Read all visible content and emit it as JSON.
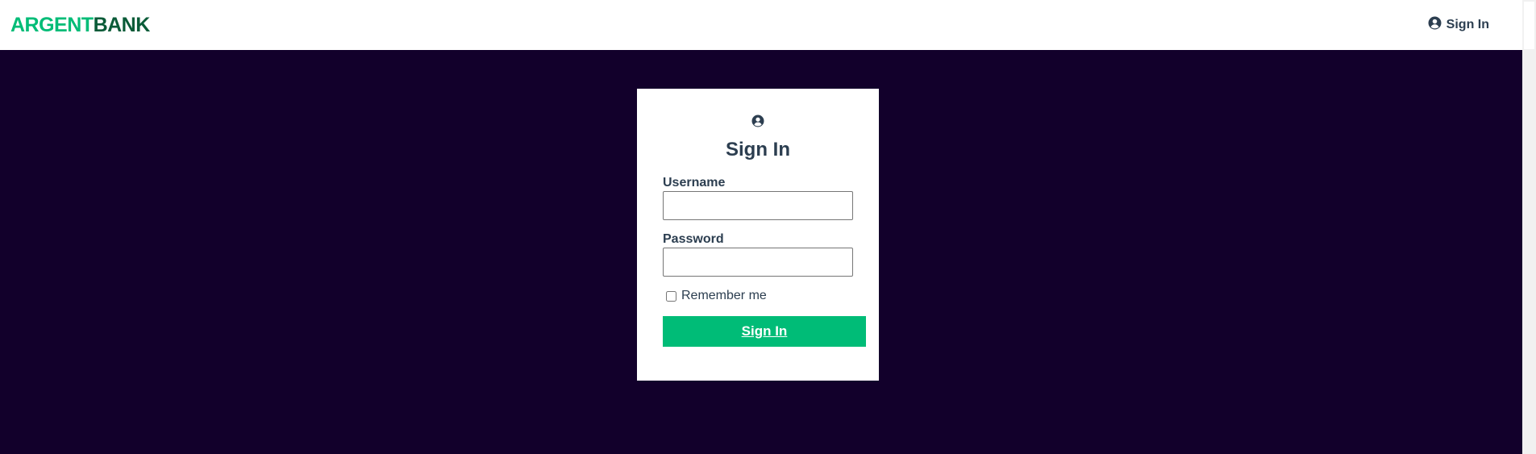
{
  "navbar": {
    "logo": {
      "part1": "ARGENT",
      "part2": "BANK"
    },
    "signin_link": "Sign In",
    "signin_icon": "user-circle-icon"
  },
  "card": {
    "icon": "user-circle-icon",
    "title": "Sign In",
    "username_label": "Username",
    "username_value": "",
    "password_label": "Password",
    "password_value": "",
    "remember_label": "Remember me",
    "remember_checked": false,
    "submit_label": "Sign In"
  },
  "colors": {
    "brand_green": "#00bc77",
    "brand_dark_green": "#0a5b38",
    "background": "#12002b",
    "text": "#2c3e50"
  }
}
